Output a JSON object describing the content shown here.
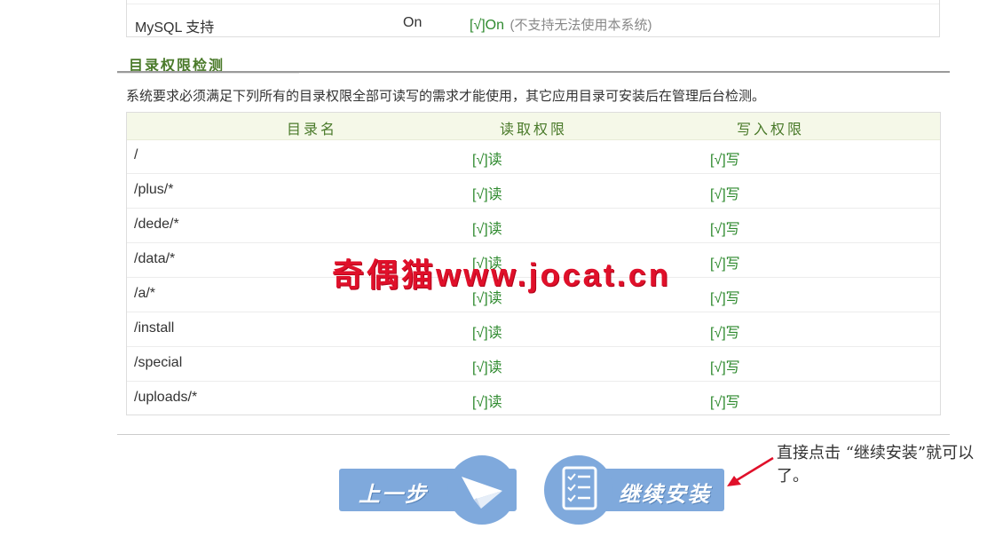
{
  "env_check": {
    "mysql": {
      "label": "MySQL 支持",
      "current": "On",
      "status": "[√]On",
      "note": "(不支持无法使用本系统)"
    }
  },
  "dir_check": {
    "title": "目录权限检测",
    "description": "系统要求必须满足下列所有的目录权限全部可读写的需求才能使用，其它应用目录可安装后在管理后台检测。",
    "headers": {
      "name": "目录名",
      "read": "读取权限",
      "write": "写入权限"
    },
    "rows": [
      {
        "name": "/",
        "read": "[√]读",
        "write": "[√]写"
      },
      {
        "name": "/plus/*",
        "read": "[√]读",
        "write": "[√]写"
      },
      {
        "name": "/dede/*",
        "read": "[√]读",
        "write": "[√]写"
      },
      {
        "name": "/data/*",
        "read": "[√]读",
        "write": "[√]写"
      },
      {
        "name": "/a/*",
        "read": "[√]读",
        "write": "[√]写"
      },
      {
        "name": "/install",
        "read": "[√]读",
        "write": "[√]写"
      },
      {
        "name": "/special",
        "read": "[√]读",
        "write": "[√]写"
      },
      {
        "name": "/uploads/*",
        "read": "[√]读",
        "write": "[√]写"
      }
    ]
  },
  "watermark": "奇偶猫www.jocat.cn",
  "buttons": {
    "prev": "上一步",
    "next": "继续安装"
  },
  "annotation": "直接点击 “继续安装”就可以了。",
  "colors": {
    "ok_green": "#2f8a2f",
    "section_green": "#4a7a2a",
    "button_blue": "#7fa9dc",
    "watermark_red": "#e0102a"
  }
}
